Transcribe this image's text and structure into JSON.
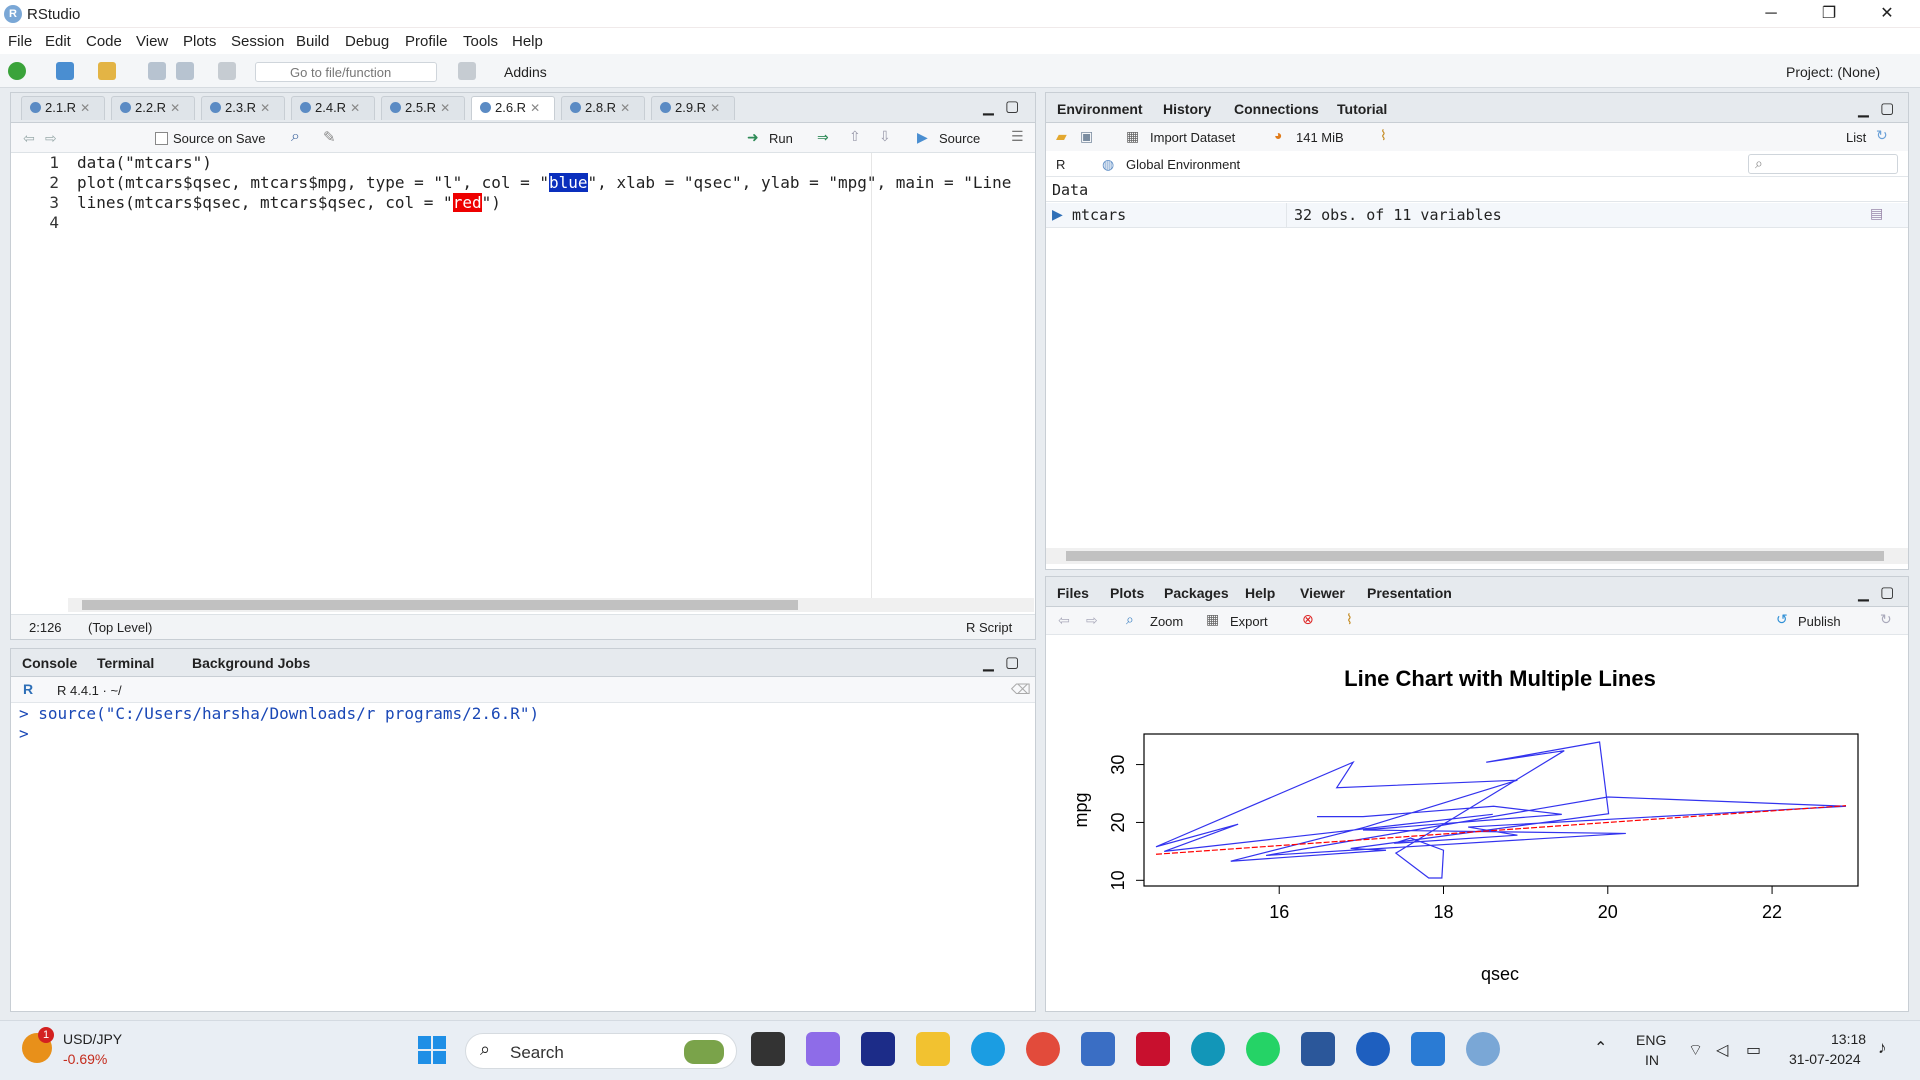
{
  "window": {
    "title": "RStudio",
    "min": "─",
    "max": "❐",
    "close": "✕"
  },
  "menu": [
    "File",
    "Edit",
    "Code",
    "View",
    "Plots",
    "Session",
    "Build",
    "Debug",
    "Profile",
    "Tools",
    "Help"
  ],
  "toolbar": {
    "goto_placeholder": "Go to file/function",
    "addins": "Addins",
    "project": "Project: (None)"
  },
  "editor": {
    "tabs": [
      "2.1.R",
      "2.2.R",
      "2.3.R",
      "2.4.R",
      "2.5.R",
      "2.6.R",
      "2.8.R",
      "2.9.R"
    ],
    "active_tab": "2.6.R",
    "source_on_save": "Source on Save",
    "run": "Run",
    "source": "Source",
    "lines": {
      "l1": "data(\"mtcars\")",
      "l2a": "plot(mtcars$qsec, mtcars$mpg, type = \"l\", col = \"",
      "l2b": "blue",
      "l2c": "\", xlab = \"qsec\", ylab = \"mpg\", main = \"Line",
      "l3a": "lines(mtcars$qsec, mtcars$qsec, col = \"",
      "l3b": "red",
      "l3c": "\")"
    },
    "line_numbers": [
      "1",
      "2",
      "3",
      "4"
    ],
    "status": {
      "pos": "2:126",
      "scope": "(Top Level)",
      "type": "R Script"
    }
  },
  "console": {
    "tabs": [
      "Console",
      "Terminal",
      "Background Jobs"
    ],
    "version": "R 4.4.1 · ~/",
    "cmd": "> source(\"C:/Users/harsha/Downloads/r programs/2.6.R\")",
    "prompt": ">"
  },
  "environment": {
    "tabs": [
      "Environment",
      "History",
      "Connections",
      "Tutorial"
    ],
    "import": "Import Dataset",
    "memory": "141 MiB",
    "list": "List",
    "r_label": "R",
    "global": "Global Environment",
    "section": "Data",
    "var_name": "mtcars",
    "var_value": "32 obs. of 11 variables"
  },
  "plots_pane": {
    "tabs": [
      "Files",
      "Plots",
      "Packages",
      "Help",
      "Viewer",
      "Presentation"
    ],
    "zoom": "Zoom",
    "export": "Export",
    "publish": "Publish"
  },
  "chart_data": {
    "type": "line",
    "title": "Line Chart with Multiple Lines",
    "xlabel": "qsec",
    "ylabel": "mpg",
    "xlim": [
      14.5,
      22.9
    ],
    "ylim": [
      10.4,
      33.9
    ],
    "x_ticks": [
      "16",
      "18",
      "20",
      "22"
    ],
    "y_ticks": [
      "10",
      "20",
      "30"
    ],
    "series": [
      {
        "color": "#3333ee",
        "x": [
          16.46,
          17.02,
          18.61,
          19.44,
          17.02,
          20.22,
          15.84,
          20.0,
          22.9,
          18.3,
          18.9,
          17.4,
          17.6,
          18.0,
          17.98,
          17.82,
          17.42,
          19.47,
          18.52,
          19.9,
          20.01,
          16.87,
          17.3,
          15.41,
          17.05,
          18.9,
          16.7,
          16.9,
          14.5,
          15.5,
          14.6,
          18.6
        ],
        "y": [
          21.0,
          21.0,
          22.8,
          21.4,
          18.7,
          18.1,
          14.3,
          24.4,
          22.8,
          19.2,
          17.8,
          16.4,
          17.3,
          15.2,
          10.4,
          10.4,
          14.7,
          32.4,
          30.4,
          33.9,
          21.5,
          15.5,
          15.2,
          13.3,
          19.2,
          27.3,
          26.0,
          30.4,
          15.8,
          19.7,
          15.0,
          21.4
        ]
      },
      {
        "color": "#ff0000",
        "x": [
          14.5,
          22.9
        ],
        "y": [
          14.5,
          22.9
        ]
      }
    ]
  },
  "taskbar": {
    "ticker": "USD/JPY",
    "change": "-0.69%",
    "search": "Search",
    "lang1": "ENG",
    "lang2": "IN",
    "time": "13:18",
    "date": "31-07-2024"
  }
}
